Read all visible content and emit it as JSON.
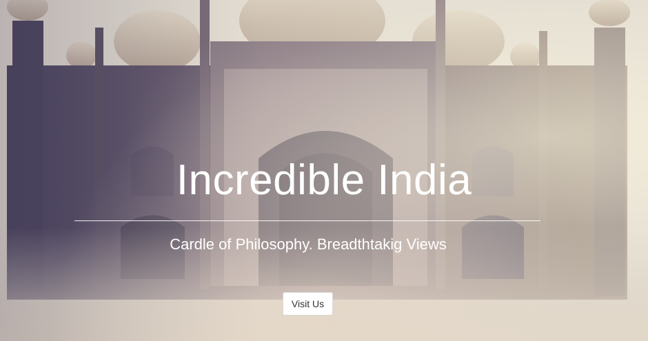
{
  "hero": {
    "title": "Incredible India",
    "subtitle": "Cardle of Philosophy. Breadthtakig Views",
    "cta_label": "Visit Us"
  },
  "colors": {
    "text": "#ffffff",
    "button_bg": "#ffffff",
    "button_text": "#333333",
    "stone": "#6f6377"
  }
}
